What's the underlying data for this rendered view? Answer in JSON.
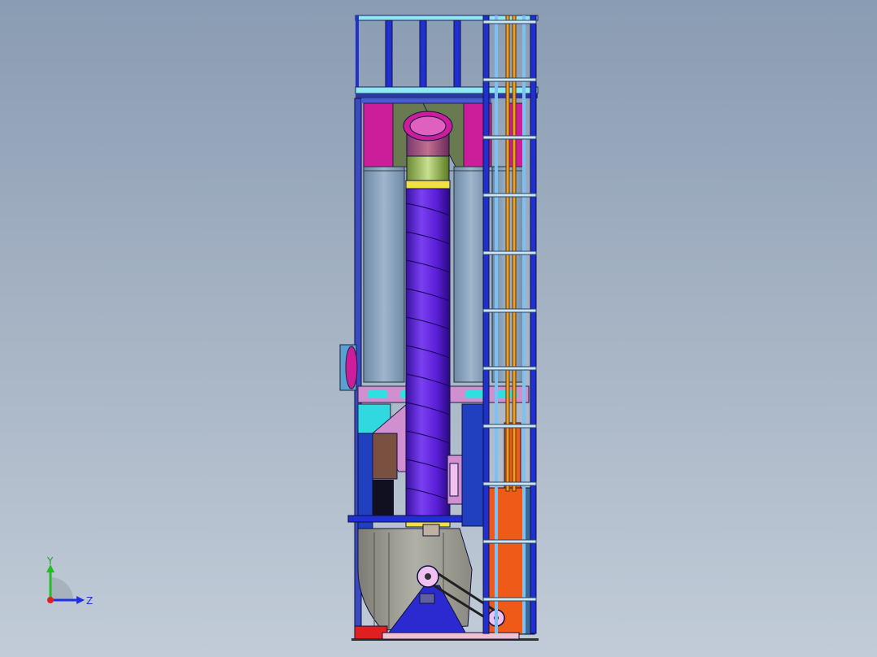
{
  "viewport": {
    "background_top": "#8a9cb3",
    "background_bottom": "#c2ccd8"
  },
  "triad": {
    "y_label": "Y",
    "z_label": "Z",
    "y_color": "#20c020",
    "z_color": "#2030e0",
    "x_color": "#e02020"
  },
  "model": {
    "duct_color": "#5a1fd6",
    "ladder_color": "#f0a020",
    "panel_magenta": "#cc1e9a",
    "panel_steel": "#8fa8bf",
    "frame_blue": "#2030d0",
    "fan_housing": "#a8a8a0",
    "base_orange": "#f05a18"
  }
}
